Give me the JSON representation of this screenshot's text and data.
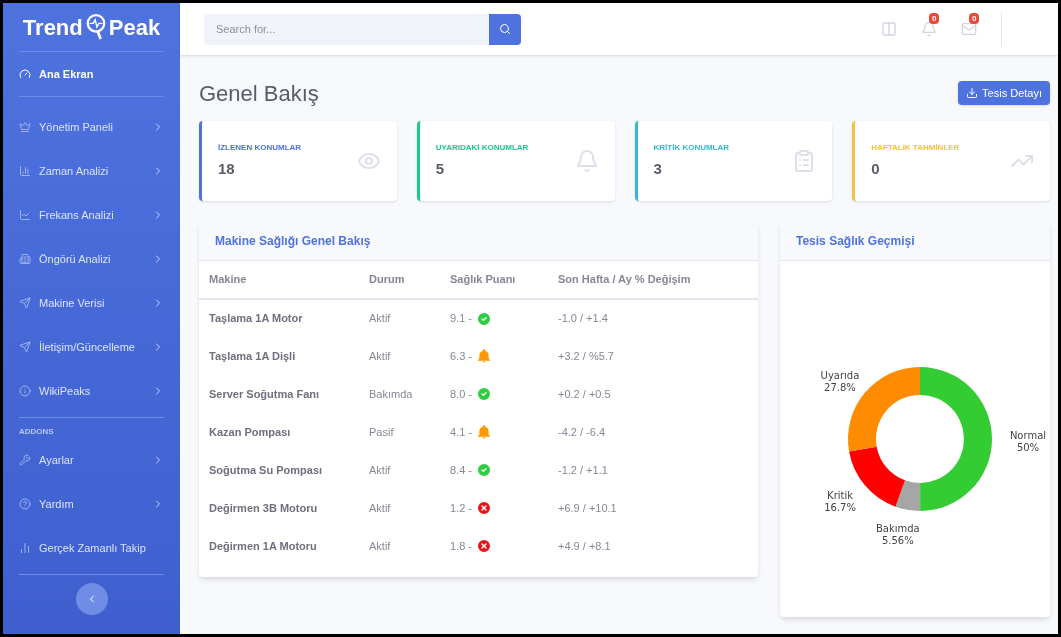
{
  "brand": {
    "left": "Trend",
    "right": "Peak"
  },
  "sidebar": {
    "items": [
      {
        "label": "Ana Ekran",
        "selected": true,
        "expandable": false
      },
      {
        "label": "Yönetim Paneli",
        "selected": false,
        "expandable": true
      },
      {
        "label": "Zaman Analizi",
        "selected": false,
        "expandable": true
      },
      {
        "label": "Frekans Analizi",
        "selected": false,
        "expandable": true
      },
      {
        "label": "Öngörü Analizi",
        "selected": false,
        "expandable": true
      },
      {
        "label": "Makine Verisi",
        "selected": false,
        "expandable": true
      },
      {
        "label": "İletişim/Güncelleme",
        "selected": false,
        "expandable": true
      }
    ],
    "items_2": [
      {
        "label": "WikiPeaks",
        "selected": false,
        "expandable": true
      }
    ],
    "section_heading": "ADDONS",
    "addons": [
      {
        "label": "Ayarlar",
        "selected": false,
        "expandable": true
      },
      {
        "label": "Yardım",
        "selected": false,
        "expandable": true
      },
      {
        "label": "Gerçek Zamanlı Takip",
        "selected": false,
        "expandable": false
      }
    ]
  },
  "topbar": {
    "search": {
      "placeholder": "Search for..."
    },
    "alerts_badge": "0",
    "messages_badge": "0"
  },
  "page_title": "Genel Bakış",
  "action_button": "Tesis Detayı",
  "stats": [
    {
      "label": "İZLENEN KONUMLAR",
      "value": "18",
      "color": "#4e73df"
    },
    {
      "label": "UYARIDAKİ KONUMLAR",
      "value": "5",
      "color": "#1cc88a"
    },
    {
      "label": "KRİTİK KONUMLAR",
      "value": "3",
      "color": "#36b9cc"
    },
    {
      "label": "HAFTALIK TAHMİNLER",
      "value": "0",
      "color": "#f6c23e"
    }
  ],
  "table": {
    "title": "Makine Sağlığı Genel Bakış",
    "columns": [
      "Makine",
      "Durum",
      "Sağlık Puanı",
      "Son Hafta / Ay % Değişim"
    ],
    "rows": [
      {
        "machine": "Taşlama 1A Motor",
        "status": "Aktif",
        "score": "9.1 -",
        "kind": "ok",
        "change": "-1.0 / +1.4"
      },
      {
        "machine": "Taşlama 1A Dişli",
        "status": "Aktif",
        "score": "6.3 -",
        "kind": "warn",
        "change": "+3.2 / %5.7"
      },
      {
        "machine": "Server Soğutma Fanı",
        "status": "Bakımda",
        "score": "8.0 -",
        "kind": "ok",
        "change": "+0.2 / +0.5"
      },
      {
        "machine": "Kazan Pompası",
        "status": "Pasif",
        "score": "4.1 -",
        "kind": "warn",
        "change": "-4.2 / -6.4"
      },
      {
        "machine": "Soğutma Su Pompası",
        "status": "Aktif",
        "score": "8.4 -",
        "kind": "ok",
        "change": "-1.2 / +1.1"
      },
      {
        "machine": "Değirmen 3B Motoru",
        "status": "Aktif",
        "score": "1.2 -",
        "kind": "critical",
        "change": "+6.9 / +10.1"
      },
      {
        "machine": "Değirmen 1A Motoru",
        "status": "Aktif",
        "score": "1.8 -",
        "kind": "critical",
        "change": "+4.9 / +8.1"
      }
    ]
  },
  "health_history": {
    "title": "Tesis Sağlık Geçmişi",
    "chart_data": {
      "type": "donut",
      "categories": [
        "Normal",
        "Bakımda",
        "Kritik",
        "Uyarıda"
      ],
      "values": [
        50,
        5.56,
        16.7,
        27.8
      ],
      "colors": [
        "#33cc33",
        "#a6a6a6",
        "#ff0000",
        "#ff8c00"
      ],
      "value_labels": [
        "50%",
        "5.56%",
        "16.7%",
        "27.8%"
      ]
    }
  }
}
